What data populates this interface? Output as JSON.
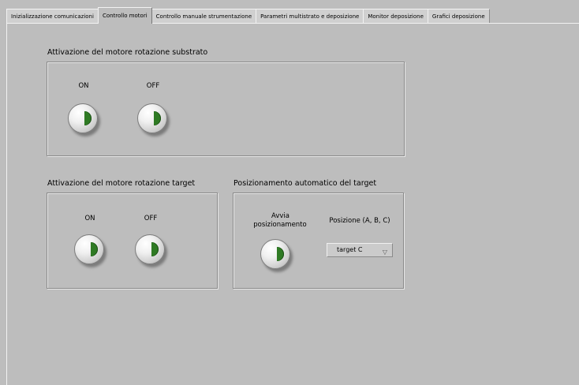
{
  "tabs": [
    {
      "label": "Inizializzazione comunicazioni"
    },
    {
      "label": "Controllo motori"
    },
    {
      "label": "Controllo manuale strumentazione"
    },
    {
      "label": "Parametri multistrato e deposizione"
    },
    {
      "label": "Monitor deposizione"
    },
    {
      "label": "Grafici deposizione"
    }
  ],
  "active_tab": "Controllo motori",
  "substrate": {
    "title": "Attivazione del motore rotazione substrato",
    "on_label": "ON",
    "off_label": "OFF"
  },
  "target_motor": {
    "title": "Attivazione del motore rotazione target",
    "on_label": "ON",
    "off_label": "OFF"
  },
  "auto_position": {
    "title": "Posizionamento automatico del target",
    "start_label_line1": "Avvia",
    "start_label_line2": "posizionamento",
    "position_label": "Posizione (A, B, C)",
    "position_value": "target C"
  },
  "colors": {
    "background": "#bdbdbd",
    "led_green": "#2f7a24"
  }
}
